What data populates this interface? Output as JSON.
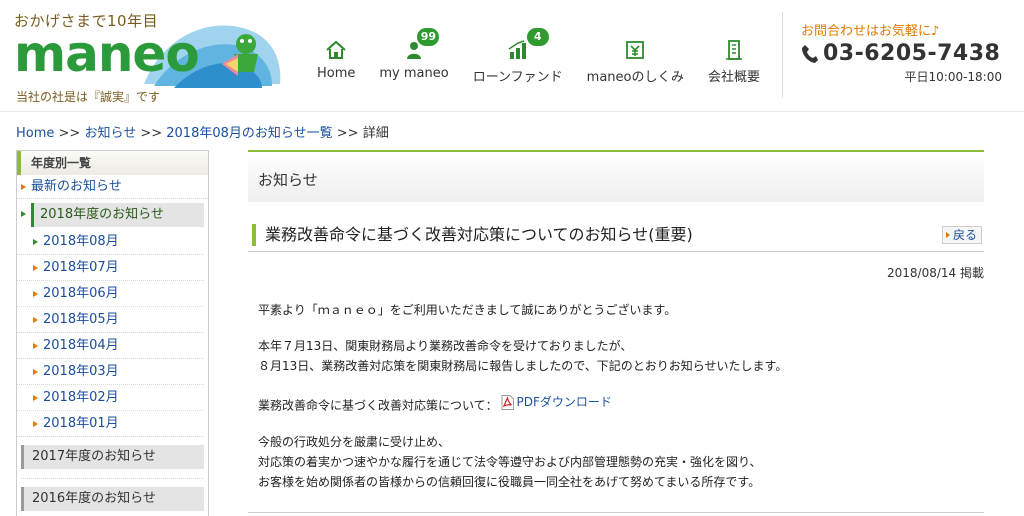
{
  "header": {
    "logo_tagline": "おかげさまで10年目",
    "logo_word": "maneo",
    "logo_motto": "当社の社是は『誠実』です",
    "nav": [
      {
        "label": "Home",
        "badge": ""
      },
      {
        "label": "my maneo",
        "badge": "99"
      },
      {
        "label": "ローンファンド",
        "badge": "4"
      },
      {
        "label": "maneoのしくみ",
        "badge": ""
      },
      {
        "label": "会社概要",
        "badge": ""
      }
    ],
    "contact_lead": "お問合わせはお気軽に♪",
    "contact_number": "03-6205-7438",
    "contact_hours": "平日10:00-18:00"
  },
  "breadcrumb": {
    "home": "Home",
    "sep1": " >> ",
    "news": "お知らせ",
    "sep2": " >> ",
    "month_list": "2018年08月のお知らせ一覧",
    "sep3": " >> ",
    "current": "詳細"
  },
  "sidebar": {
    "heading": "年度別一覧",
    "latest": "最新のお知らせ",
    "active_year": "2018年度のお知らせ",
    "months": [
      "2018年08月",
      "2018年07月",
      "2018年06月",
      "2018年05月",
      "2018年04月",
      "2018年03月",
      "2018年02月",
      "2018年01月"
    ],
    "other_years": [
      "2017年度のお知らせ",
      "2016年度のお知らせ"
    ]
  },
  "main": {
    "section_title": "お知らせ",
    "article_title": "業務改善命令に基づく改善対応策についてのお知らせ(重要)",
    "back_label": "戻る",
    "post_date": "2018/08/14 掲載",
    "para1": "平素より「ｍａｎｅｏ」をご利用いただきまして誠にありがとうございます。",
    "para2_line1": "本年７月13日、関東財務局より業務改善命令を受けておりましたが、",
    "para2_line2": "８月13日、業務改善対応策を関東財務局に報告しましたので、下記のとおりお知らせいたします。",
    "para3_lead": "業務改善命令に基づく改善対応策について：",
    "pdf_label": "PDFダウンロード",
    "para4_line1": "今般の行政処分を厳粛に受け止め、",
    "para4_line2": "対応策の着実かつ速やかな履行を通じて法令等遵守および内部管理態勢の充実・強化を図り、",
    "para4_line3": "お客様を始め関係者の皆様からの信頼回復に役職員一同全社をあげて努めてまいる所存です。"
  },
  "colors": {
    "brand_green": "#2a9a3a",
    "accent_green": "#8bbd3a",
    "link_blue": "#1a4f9c",
    "accent_orange": "#e07a00"
  }
}
